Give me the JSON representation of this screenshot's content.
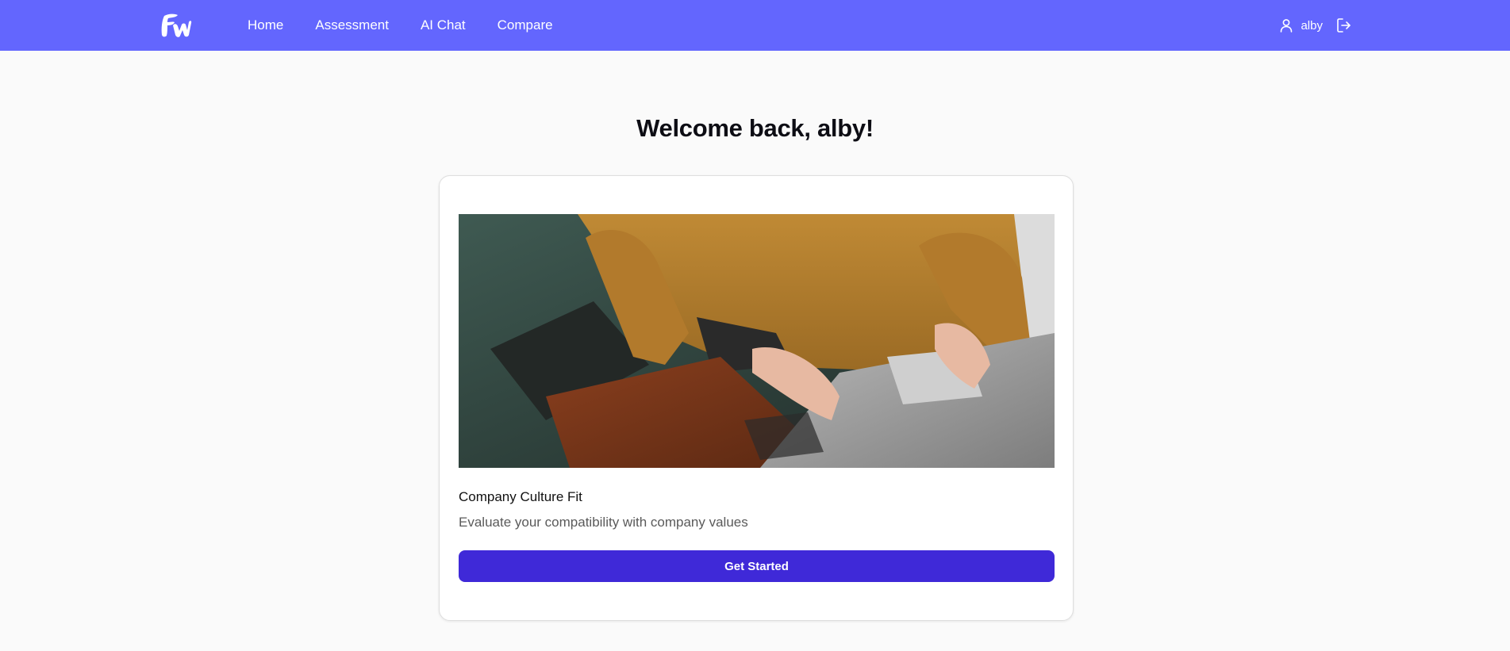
{
  "nav": {
    "logo": "FW logo",
    "links": [
      {
        "label": "Home"
      },
      {
        "label": "Assessment"
      },
      {
        "label": "AI Chat"
      },
      {
        "label": "Compare"
      }
    ],
    "user": {
      "name": "alby",
      "icon": "user-icon",
      "logout_icon": "logout-icon"
    }
  },
  "main": {
    "welcome": "Welcome back, alby!",
    "card": {
      "image": "hands typing on laptop",
      "title": "Company Culture Fit",
      "description": "Evaluate your compatibility with company values",
      "button_label": "Get Started"
    }
  },
  "colors": {
    "nav_bg": "#6366fe",
    "button_bg": "#3f29d8",
    "page_bg": "#fafafa"
  }
}
